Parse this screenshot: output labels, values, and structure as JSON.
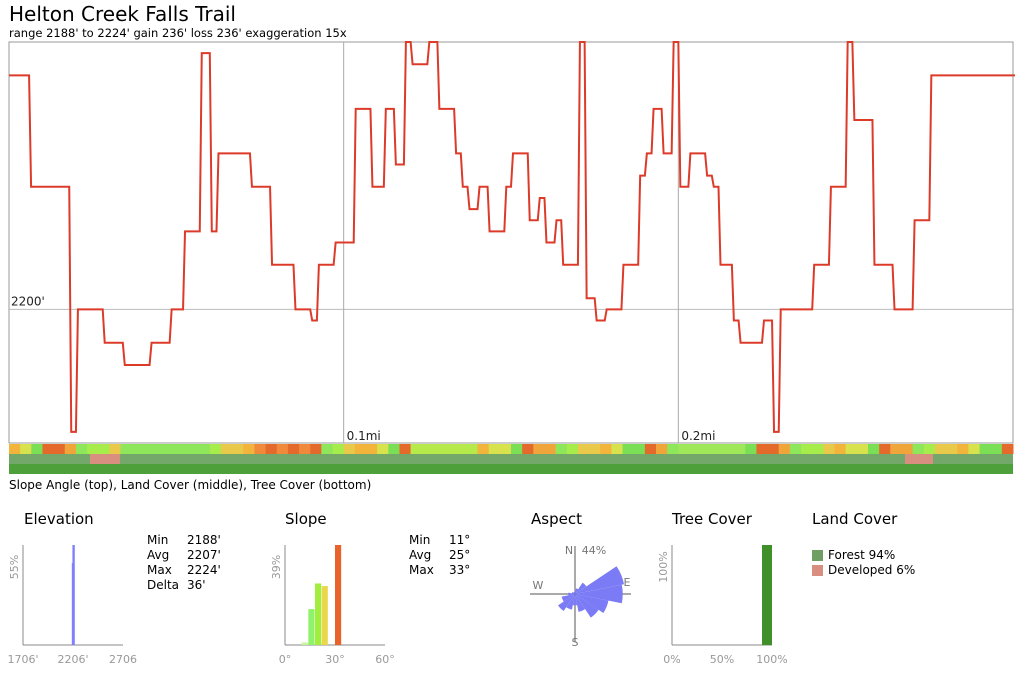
{
  "title": "Helton Creek Falls Trail",
  "subtitle": "range 2188' to 2224'  gain 236'  loss 236'  exaggeration 15x",
  "caption": "Slope Angle (top), Land Cover (middle), Tree Cover (bottom)",
  "colors": {
    "profile_line": "#dd3b2a",
    "elevation_bar": "#8080ff",
    "aspect_petal": "#7b7bf5",
    "tree_bar": "#3f8f2a",
    "forest": "#6f9f63",
    "developed": "#d98f7f",
    "axis": "#888888"
  },
  "chart_data": [
    {
      "type": "line",
      "name": "elevation-profile",
      "ylim": [
        2188,
        2224
      ],
      "xlim": [
        0,
        0.3
      ],
      "gridline_label": "2200'",
      "distance_labels": [
        "0.1mi",
        "0.2mi"
      ],
      "distance_ticks": [
        0.1,
        0.2
      ],
      "x": [
        0,
        0.003,
        0.006,
        0.012,
        0.018,
        0.02,
        0.024,
        0.028,
        0.03,
        0.034,
        0.038,
        0.042,
        0.046,
        0.048,
        0.052,
        0.054,
        0.057,
        0.06,
        0.062,
        0.07,
        0.072,
        0.076,
        0.078,
        0.082,
        0.085,
        0.088,
        0.09,
        0.092,
        0.094,
        0.097,
        0.1,
        0.103,
        0.105,
        0.108,
        0.11,
        0.112,
        0.115,
        0.118,
        0.12,
        0.122,
        0.125,
        0.128,
        0.13,
        0.133,
        0.135,
        0.137,
        0.14,
        0.143,
        0.146,
        0.148,
        0.15,
        0.152,
        0.155,
        0.158,
        0.16,
        0.163,
        0.165,
        0.168,
        0.17,
        0.172,
        0.175,
        0.178,
        0.18,
        0.183,
        0.186,
        0.188,
        0.19,
        0.192,
        0.195,
        0.198,
        0.2,
        0.203,
        0.206,
        0.208,
        0.21,
        0.212,
        0.214,
        0.216,
        0.218,
        0.22,
        0.222,
        0.225,
        0.228,
        0.23,
        0.235,
        0.24,
        0.245,
        0.248,
        0.25,
        0.252,
        0.255,
        0.258,
        0.26,
        0.264,
        0.268,
        0.27,
        0.275,
        0.28,
        0.285,
        0.29,
        0.295,
        0.3
      ],
      "y": [
        2221,
        2221,
        2211,
        2211,
        2189,
        2200,
        2200,
        2197,
        2197,
        2195,
        2195,
        2197,
        2197,
        2200,
        2207,
        2207,
        2223,
        2207,
        2214,
        2214,
        2211,
        2211,
        2204,
        2204,
        2200,
        2200,
        2199,
        2204,
        2204,
        2206,
        2206,
        2218,
        2218,
        2211,
        2211,
        2218,
        2213,
        2224,
        2222,
        2222,
        2224,
        2218,
        2218,
        2214,
        2211,
        2209,
        2211,
        2207,
        2207,
        2211,
        2214,
        2214,
        2208,
        2210,
        2206,
        2208,
        2204,
        2204,
        2224,
        2201,
        2199,
        2200,
        2200,
        2204,
        2204,
        2212,
        2214,
        2218,
        2214,
        2224,
        2211,
        2214,
        2214,
        2212,
        2211,
        2204,
        2204,
        2199,
        2197,
        2197,
        2197,
        2199,
        2189,
        2200,
        2200,
        2204,
        2211,
        2211,
        2224,
        2217,
        2217,
        2204,
        2204,
        2200,
        2200,
        2208,
        2221,
        2221,
        2221,
        2221,
        2221,
        2221
      ]
    },
    {
      "type": "bar",
      "name": "elevation-histogram",
      "title": "Elevation",
      "tick_labels": [
        "1706'",
        "2206'",
        "2706"
      ],
      "y_tick_label": "55%",
      "bin_edges": [
        2188,
        2194,
        2200,
        2224
      ],
      "values": [
        0,
        45,
        55
      ],
      "stats": [
        {
          "label": "Min",
          "value": "2188'"
        },
        {
          "label": "Avg",
          "value": "2207'"
        },
        {
          "label": "Max",
          "value": "2224'"
        },
        {
          "label": "Delta",
          "value": "36'"
        }
      ]
    },
    {
      "type": "bar",
      "name": "slope-histogram",
      "title": "Slope",
      "tick_labels": [
        "0°",
        "30°",
        "60°"
      ],
      "y_tick_label": "39%",
      "categories": [
        "10-14°",
        "14-18°",
        "18-22°",
        "22-26°",
        "26-30°",
        "30-34°"
      ],
      "values": [
        1,
        14,
        24,
        23,
        0,
        39
      ],
      "bar_colors": [
        "#c8f59a",
        "#8ef36a",
        "#a2ee3e",
        "#e9d84c",
        "#f0a93a",
        "#e8622c"
      ],
      "stats": [
        {
          "label": "Min",
          "value": "11°"
        },
        {
          "label": "Avg",
          "value": "25°"
        },
        {
          "label": "Max",
          "value": "33°"
        }
      ]
    },
    {
      "type": "polar",
      "name": "aspect-rose",
      "title": "Aspect",
      "n_label": "N",
      "peak_label": "44%",
      "compass": [
        "N",
        "E",
        "S",
        "W"
      ],
      "directions_deg": [
        0,
        22.5,
        45,
        67.5,
        90,
        112.5,
        135,
        157.5,
        180,
        202.5,
        225,
        247.5,
        270,
        292.5,
        315,
        337.5
      ],
      "values": [
        3,
        5,
        12,
        44,
        42,
        30,
        25,
        16,
        10,
        14,
        18,
        12,
        6,
        3,
        2,
        2
      ]
    },
    {
      "type": "bar",
      "name": "tree-cover-histogram",
      "title": "Tree Cover",
      "tick_labels": [
        "0%",
        "50%",
        "100%"
      ],
      "y_tick_label": "100%",
      "x": [
        95
      ],
      "values": [
        100
      ]
    }
  ],
  "land_cover": {
    "title": "Land Cover",
    "items": [
      {
        "label": "Forest 94%",
        "color": "#6f9f63"
      },
      {
        "label": "Developed 6%",
        "color": "#d98f7f"
      }
    ]
  }
}
